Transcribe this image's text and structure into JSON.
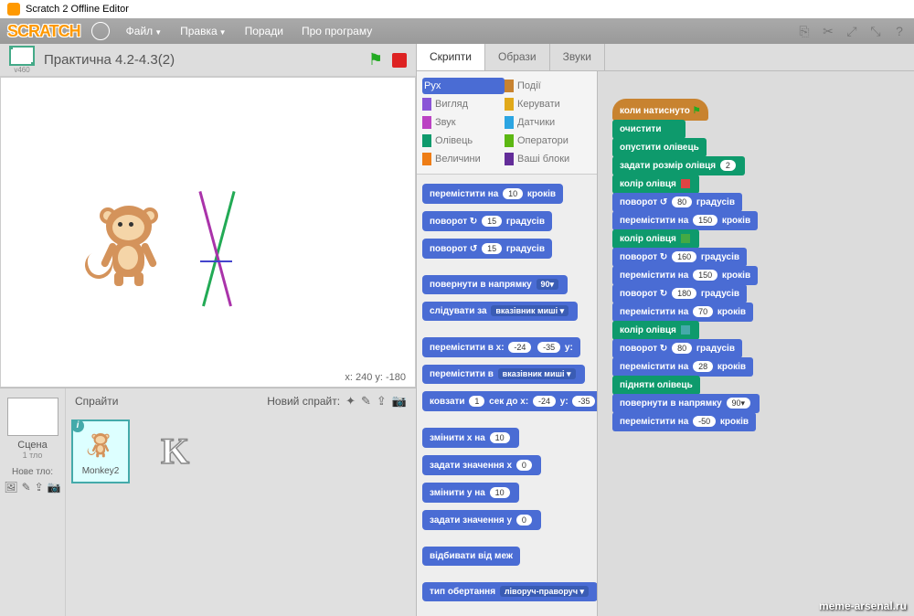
{
  "window": {
    "title": "Scratch 2 Offline Editor"
  },
  "menu": {
    "file": "Файл",
    "edit": "Правка",
    "tips": "Поради",
    "about": "Про програму"
  },
  "project": {
    "title": "Практична 4.2-4.3(2)",
    "version": "v460"
  },
  "coords": {
    "label": "x: 240  y: -180"
  },
  "sprites": {
    "title": "Спрайти",
    "new_label": "Новий спрайт:",
    "scene": "Сцена",
    "scene_sub": "1 тло",
    "new_bg": "Нове тло:",
    "sprite1": "Monkey2"
  },
  "tabs": {
    "scripts": "Скрипти",
    "costumes": "Образи",
    "sounds": "Звуки"
  },
  "categories": [
    {
      "name": "Рух",
      "color": "#4a6cd4",
      "active": true
    },
    {
      "name": "Події",
      "color": "#c88330"
    },
    {
      "name": "Вигляд",
      "color": "#8a55d7"
    },
    {
      "name": "Керувати",
      "color": "#e1a91a"
    },
    {
      "name": "Звук",
      "color": "#bb42c3"
    },
    {
      "name": "Датчики",
      "color": "#2ca5e2"
    },
    {
      "name": "Олівець",
      "color": "#0e9a6c"
    },
    {
      "name": "Оператори",
      "color": "#5cb712"
    },
    {
      "name": "Величини",
      "color": "#ee7d16"
    },
    {
      "name": "Ваші блоки",
      "color": "#632d99"
    }
  ],
  "palette_blocks": [
    {
      "t": "перемістити на",
      "p": "10",
      "s": "кроків"
    },
    {
      "t": "поворот ↻",
      "p": "15",
      "s": "градусів"
    },
    {
      "t": "поворот ↺",
      "p": "15",
      "s": "градусів"
    },
    {
      "gap": true
    },
    {
      "t": "повернути в напрямку",
      "d": "90▾"
    },
    {
      "t": "слідувати за",
      "d": "вказівник миші ▾"
    },
    {
      "gap": true
    },
    {
      "t": "перемістити в x:",
      "p": "-24",
      "s2": "y:",
      "p2": "-35"
    },
    {
      "t": "перемістити в",
      "d": "вказівник миші ▾"
    },
    {
      "t": "ковзати",
      "p": "1",
      "s": "сек до x:",
      "p2": "-24",
      "s2": "y:",
      "p3": "-35"
    },
    {
      "gap": true
    },
    {
      "t": "змінити x на",
      "p": "10"
    },
    {
      "t": "задати значення x",
      "p": "0"
    },
    {
      "t": "змінити y на",
      "p": "10"
    },
    {
      "t": "задати значення y",
      "p": "0"
    },
    {
      "gap": true
    },
    {
      "t": "відбивати від меж"
    },
    {
      "gap": true
    },
    {
      "t": "тип обертання",
      "d": "ліворуч-праворуч ▾"
    }
  ],
  "script": [
    {
      "type": "hat",
      "t": "коли натиснуто",
      "flag": true
    },
    {
      "type": "pen",
      "t": "очистити"
    },
    {
      "type": "pen",
      "t": "опустити олівець"
    },
    {
      "type": "pen",
      "t": "задати розмір олівця",
      "p": "2"
    },
    {
      "type": "pen",
      "t": "колір олівця",
      "sq": "#d44"
    },
    {
      "type": "motion",
      "t": "поворот ↺",
      "p": "80",
      "s": "градусів"
    },
    {
      "type": "motion",
      "t": "перемістити на",
      "p": "150",
      "s": "кроків"
    },
    {
      "type": "pen",
      "t": "колір олівця",
      "sq": "#4a4"
    },
    {
      "type": "motion",
      "t": "поворот ↻",
      "p": "160",
      "s": "градусів"
    },
    {
      "type": "motion",
      "t": "перемістити на",
      "p": "150",
      "s": "кроків"
    },
    {
      "type": "motion",
      "t": "поворот ↻",
      "p": "180",
      "s": "градусів"
    },
    {
      "type": "motion",
      "t": "перемістити на",
      "p": "70",
      "s": "кроків"
    },
    {
      "type": "pen",
      "t": "колір олівця",
      "sq": "#4aa"
    },
    {
      "type": "motion",
      "t": "поворот ↻",
      "p": "80",
      "s": "градусів"
    },
    {
      "type": "motion",
      "t": "перемістити на",
      "p": "28",
      "s": "кроків"
    },
    {
      "type": "pen",
      "t": "підняти олівець"
    },
    {
      "type": "motion",
      "t": "повернути в напрямку",
      "p": "90▾"
    },
    {
      "type": "motion",
      "t": "перемістити на",
      "p": "-50",
      "s": "кроків"
    }
  ],
  "watermark": "meme-arsenal.ru"
}
